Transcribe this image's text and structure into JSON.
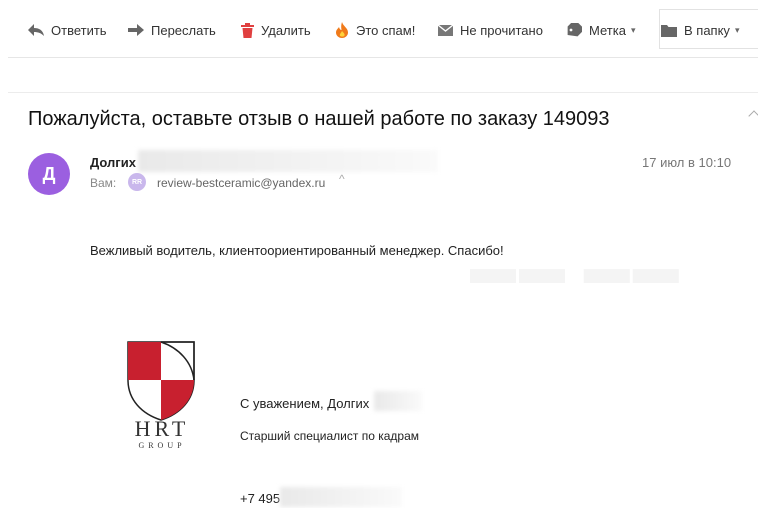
{
  "toolbar": {
    "reply": "Ответить",
    "forward": "Переслать",
    "delete": "Удалить",
    "spam": "Это спам!",
    "unread": "Не прочитано",
    "label": "Метка",
    "folder": "В папку",
    "dropdown_arrow": "▾"
  },
  "message": {
    "subject": "Пожалуйста, оставьте отзыв о нашей работе по заказу 149093",
    "avatar_letter": "Д",
    "sender_name": "Долгих",
    "date": "17 июл в 10:10",
    "to_label": "Вам:",
    "recipient_badge": "RR",
    "recipient_email": "review-bestceramic@yandex.ru",
    "recipient_toggle": "^",
    "body": "Вежливый водитель, клиентоориентированный менеджер. Спасибо!"
  },
  "signature": {
    "logo_text": "HRT",
    "logo_subtext": "GROUP",
    "regards": "С уважением, Долгих",
    "position": "Старший специалист по кадрам",
    "phone": "+7 495"
  },
  "colors": {
    "avatar": "#9b5fe0",
    "logo_red": "#c8202f",
    "delete_icon": "#e04040",
    "spam_icon": "#f07a1a"
  }
}
